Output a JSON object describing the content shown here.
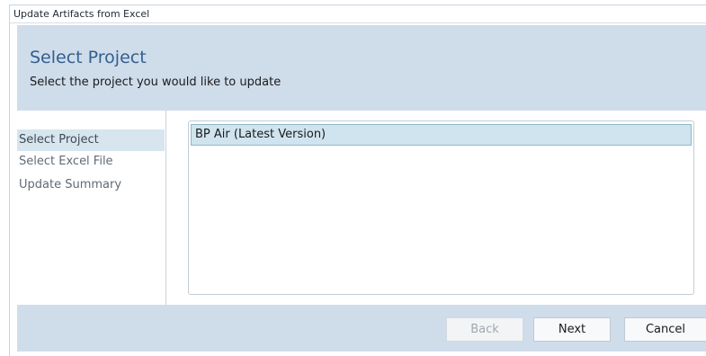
{
  "window": {
    "title": "Update Artifacts from Excel"
  },
  "header": {
    "title": "Select Project",
    "subtitle": "Select the project you would like to update"
  },
  "nav": {
    "items": [
      {
        "label": "Select Project",
        "selected": true
      },
      {
        "label": "Select Excel File",
        "selected": false
      },
      {
        "label": "Update Summary",
        "selected": false
      }
    ]
  },
  "projects": {
    "items": [
      {
        "label": "BP Air (Latest Version)",
        "selected": true
      }
    ]
  },
  "footer": {
    "back_label": "Back",
    "back_enabled": false,
    "next_label": "Next",
    "cancel_label": "Cancel"
  },
  "colors": {
    "header_bg": "#cfdcea",
    "title_color": "#335f8f",
    "nav_selected_bg": "#d6e5ee",
    "list_selected_bg": "#cfe4ee"
  }
}
